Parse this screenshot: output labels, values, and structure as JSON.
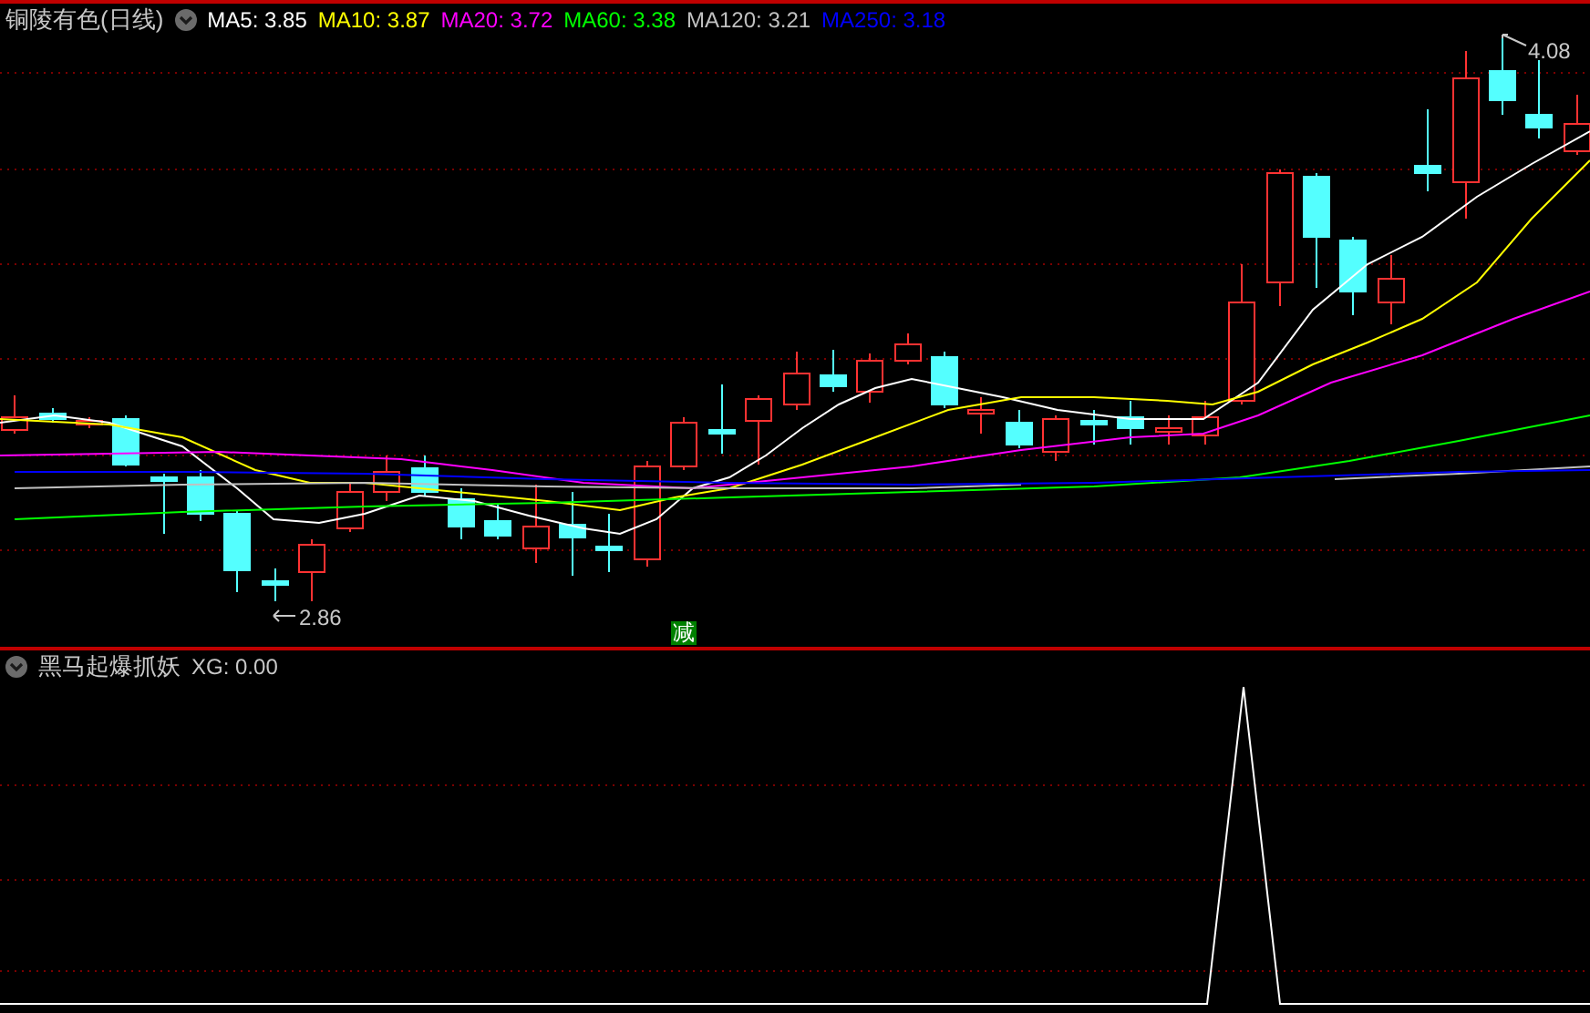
{
  "price_panel": {
    "title": "铜陵有色(日线)",
    "moving_averages": [
      {
        "text": "MA5: 3.85",
        "color": "#ffffff"
      },
      {
        "text": "MA10: 3.87",
        "color": "#ffff00"
      },
      {
        "text": "MA20: 3.72",
        "color": "#ff00ff"
      },
      {
        "text": "MA60: 3.38",
        "color": "#00ff00"
      },
      {
        "text": "MA120: 3.21",
        "color": "#c0c0c0"
      },
      {
        "text": "MA250: 3.18",
        "color": "#0000ff"
      }
    ],
    "high_label": "4.08",
    "low_label": "2.86",
    "signal_badge": "减"
  },
  "indicator_panel": {
    "title": "黑马起爆抓妖",
    "reading": "XG: 0.00"
  }
}
